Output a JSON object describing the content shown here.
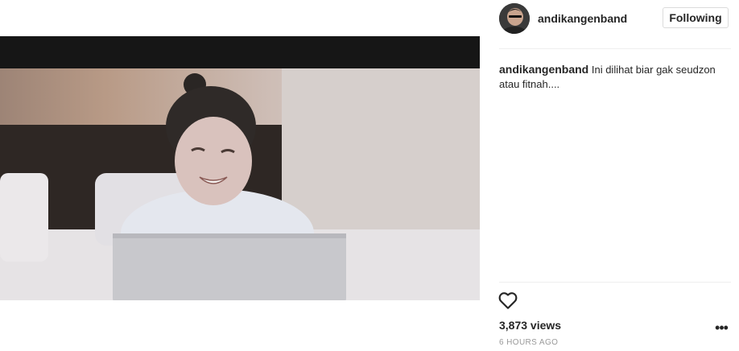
{
  "post": {
    "username": "andikangenband",
    "follow_label": "Following",
    "caption_username": "andikangenband",
    "caption_text": "Ini dilihat biar gak seudzon atau fitnah....",
    "views": "3,873 views",
    "timestamp": "6 HOURS AGO"
  },
  "icons": {
    "like": "heart-outline-icon",
    "more": "more-options-icon",
    "more_glyph": "•••"
  },
  "colors": {
    "text": "#262626",
    "muted": "#999999",
    "border": "#dbdbdb",
    "video_letterbox": "#161616"
  }
}
